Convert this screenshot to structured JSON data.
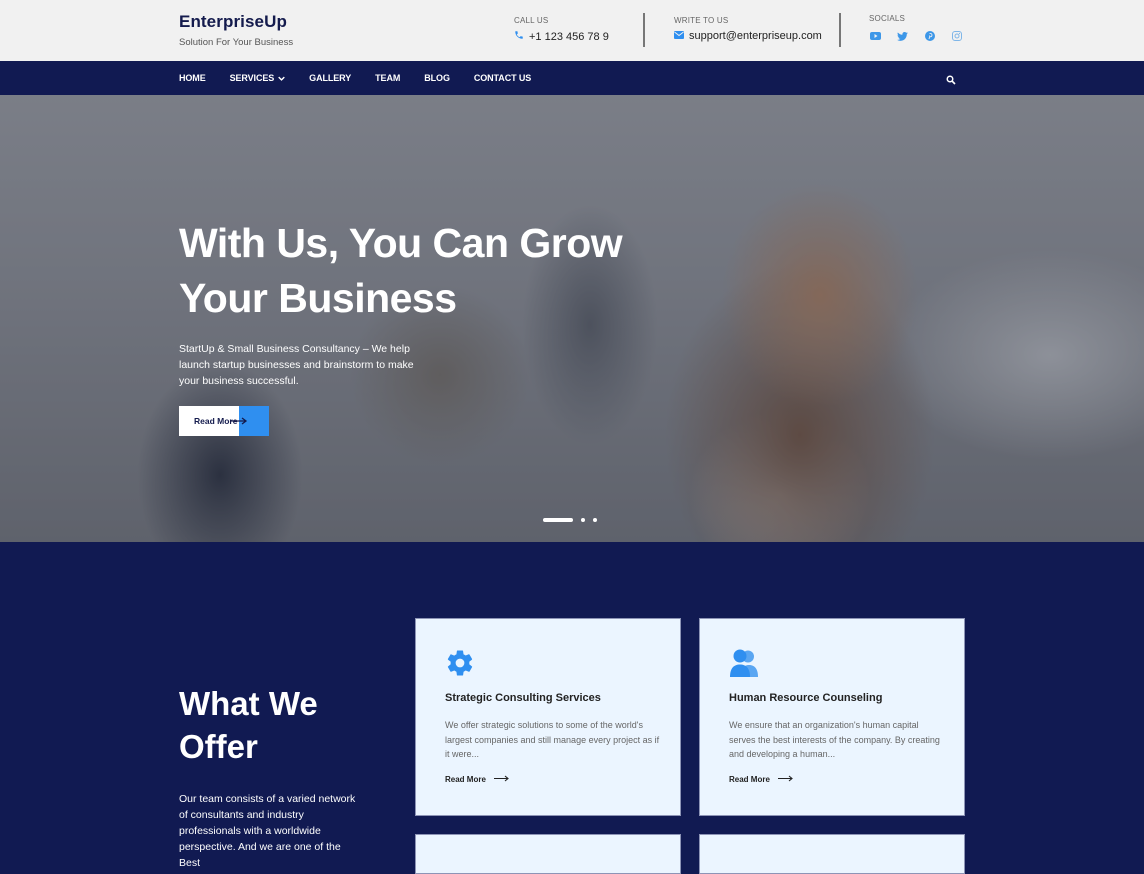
{
  "header": {
    "brand_title": "EnterpriseUp",
    "brand_tagline": "Solution For Your Business",
    "call": {
      "label": "CALL US",
      "value": "+1 123 456 78 9",
      "icon": "phone-icon"
    },
    "mail": {
      "label": "WRITE TO US",
      "value": "support@enterpriseup.com",
      "icon": "envelope-icon"
    },
    "socials": {
      "label": "SOCIALS",
      "items": [
        {
          "name": "youtube",
          "icon": "youtube-icon"
        },
        {
          "name": "twitter",
          "icon": "twitter-icon"
        },
        {
          "name": "pinterest",
          "icon": "pinterest-icon"
        },
        {
          "name": "instagram",
          "icon": "instagram-icon"
        }
      ]
    }
  },
  "nav": {
    "items": [
      {
        "label": "HOME"
      },
      {
        "label": "SERVICES",
        "has_dropdown": true
      },
      {
        "label": "GALLERY"
      },
      {
        "label": "TEAM"
      },
      {
        "label": "BLOG"
      },
      {
        "label": "CONTACT US"
      }
    ],
    "search_icon": "search-icon"
  },
  "hero": {
    "title_line1": "With Us, You Can Grow",
    "title_line2": "Your Business",
    "subtitle": "StartUp & Small Business Consultancy – We help launch startup businesses and brainstorm to make your business successful.",
    "button_label": "Read More",
    "slides": {
      "count": 3,
      "active": 1
    }
  },
  "offer": {
    "title_line1": "What We",
    "title_line2": "Offer",
    "text": "Our team consists of a varied network of consultants and industry professionals with a worldwide perspective. And we are one of the Best",
    "cards": [
      {
        "icon": "gear-icon",
        "title": "Strategic Consulting Services",
        "text": "We offer strategic solutions to some of the world's largest companies and still manage every project as if it were...",
        "link": "Read More"
      },
      {
        "icon": "users-icon",
        "title": "Human Resource Counseling",
        "text": "We ensure that an organization's human capital serves the best interests of the company. By creating and developing a human...",
        "link": "Read More"
      }
    ]
  },
  "colors": {
    "navy": "#111a52",
    "accent_blue": "#2f8ff0",
    "card_bg": "#ebf5ff",
    "topbar_bg": "#f1f1f1"
  }
}
